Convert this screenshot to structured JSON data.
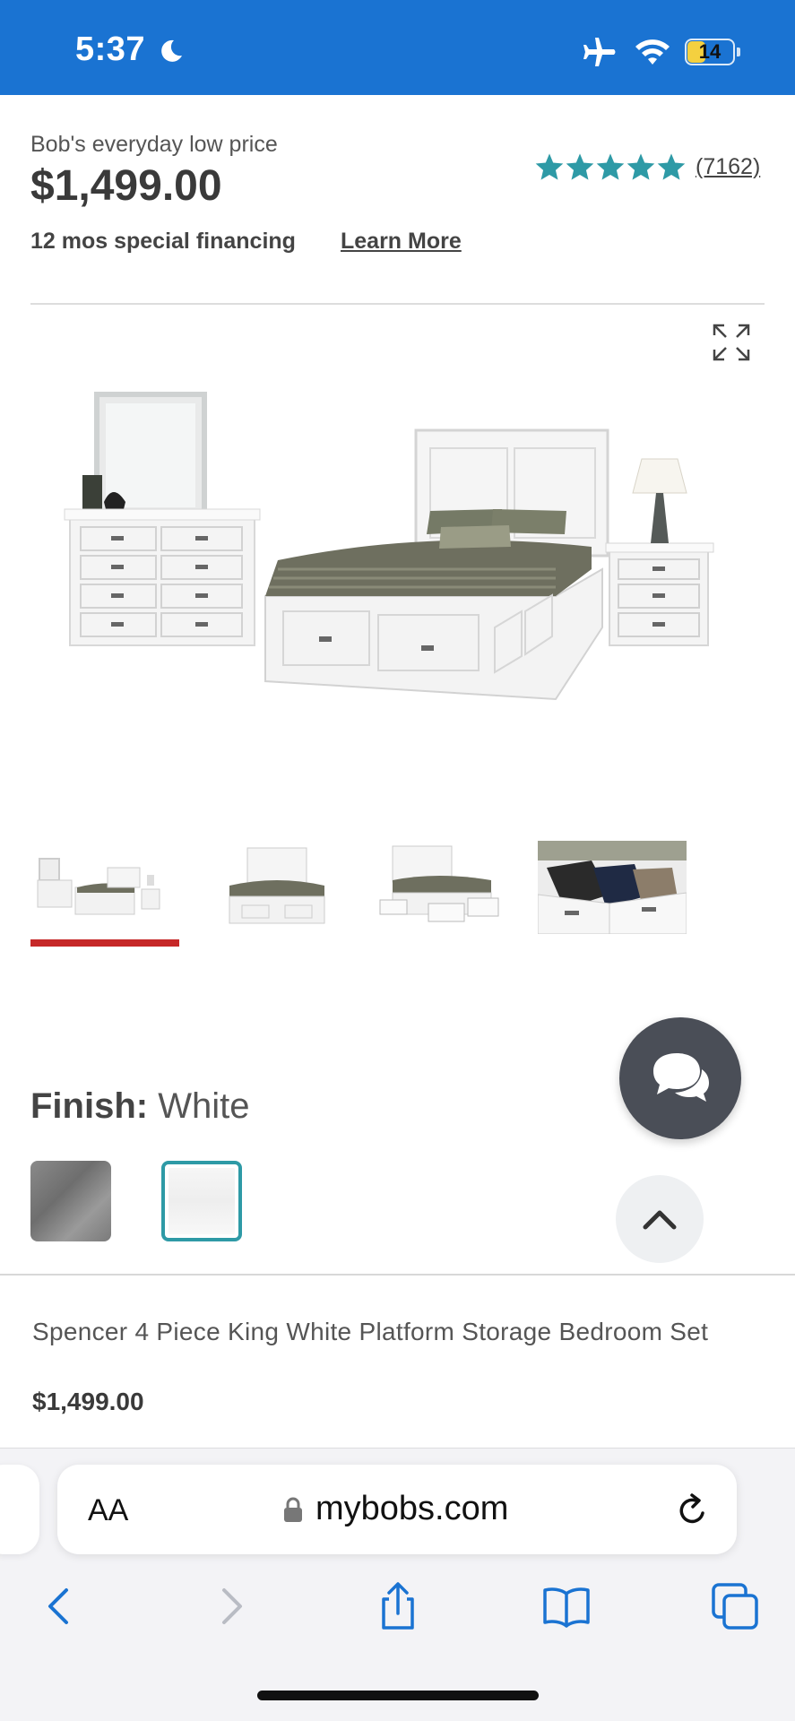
{
  "status_bar": {
    "time": "5:37",
    "battery_level": "14",
    "icons": [
      "moon-icon",
      "airplane-icon",
      "wifi-icon",
      "battery-icon"
    ]
  },
  "product": {
    "price_label": "Bob's everyday low price",
    "price": "$1,499.00",
    "rating_stars": 5,
    "review_count": "(7162)",
    "financing_text": "12 mos special financing",
    "learn_more": "Learn More",
    "finish_label": "Finish:",
    "finish_value": "White",
    "name": "Spencer 4 Piece King White Platform Storage Bedroom Set",
    "bar_price": "$1,499.00",
    "swatches": [
      "gray",
      "white"
    ],
    "selected_swatch": "white",
    "selected_thumbnail": 1
  },
  "gallery": {
    "thumbnails": [
      "full-set-thumbnail",
      "bed-thumbnail",
      "bed-drawers-open-thumbnail",
      "drawer-closeup-thumbnail"
    ]
  },
  "browser": {
    "text_size_label": "AA",
    "url": "mybobs.com"
  },
  "colors": {
    "status_bar": "#1a73d2",
    "star": "#2e9aa6",
    "thumbnail_indicator": "#c62828",
    "chat_button": "#4a4e57",
    "safari_blue": "#1a73d2"
  }
}
